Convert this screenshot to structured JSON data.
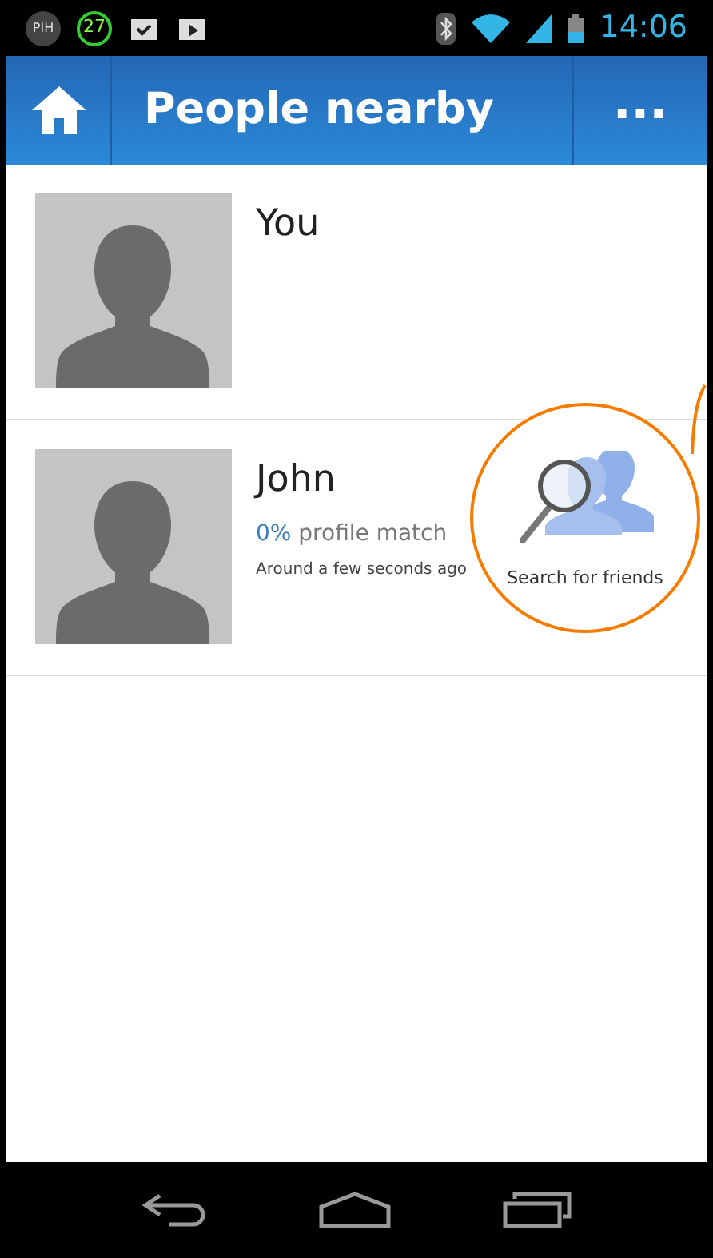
{
  "status_bar": {
    "badges": [
      "PIH",
      "27"
    ],
    "time": "14:06"
  },
  "app_bar": {
    "title": "People nearby",
    "menu": "..."
  },
  "people": [
    {
      "name": "You"
    },
    {
      "name": "John",
      "match_percent": "0%",
      "match_label": "profile match",
      "seen": "Around a few seconds ago"
    }
  ],
  "callout": {
    "label": "Search for friends"
  }
}
